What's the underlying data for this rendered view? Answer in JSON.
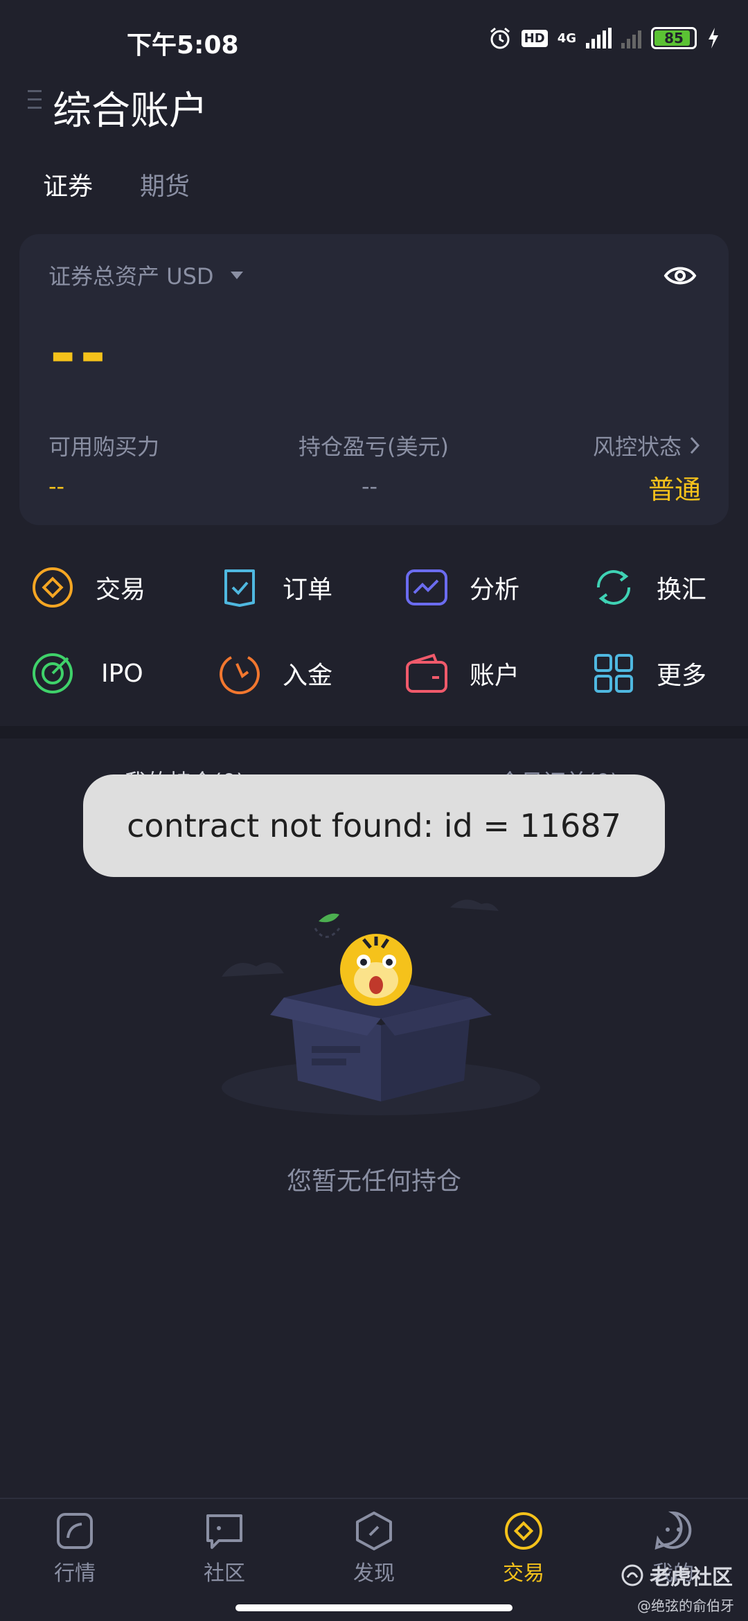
{
  "status_bar": {
    "time": "下午5:08",
    "network": "4G",
    "hd": "HD",
    "battery": "85"
  },
  "header": {
    "title": "综合账户"
  },
  "tabs": [
    {
      "label": "证券",
      "active": true
    },
    {
      "label": "期货",
      "active": false
    }
  ],
  "asset_card": {
    "label": "证券总资产 USD",
    "total_value": "--",
    "buying_power_label": "可用购买力",
    "buying_power_value": "--",
    "pnl_label": "持仓盈亏(美元)",
    "pnl_value": "--",
    "risk_label": "风控状态",
    "risk_value": "普通"
  },
  "actions": [
    {
      "label": "交易",
      "icon": "trade-icon",
      "color": "#f5a623"
    },
    {
      "label": "订单",
      "icon": "order-icon",
      "color": "#4fb8e0"
    },
    {
      "label": "分析",
      "icon": "analysis-icon",
      "color": "#6b6cf0"
    },
    {
      "label": "换汇",
      "icon": "exchange-icon",
      "color": "#3fd2b4"
    },
    {
      "label": "IPO",
      "icon": "ipo-icon",
      "color": "#3fd26a"
    },
    {
      "label": "入金",
      "icon": "deposit-icon",
      "color": "#f2772f"
    },
    {
      "label": "账户",
      "icon": "wallet-icon",
      "color": "#f05a6b"
    },
    {
      "label": "更多",
      "icon": "grid-icon",
      "color": "#4fb8e0"
    }
  ],
  "positions": {
    "tab_holdings": "我的持仓(0)",
    "tab_orders": "今日订单(0)",
    "empty_text": "您暂无任何持仓"
  },
  "toast": {
    "message": "contract not found: id = 11687"
  },
  "bottom_nav": [
    {
      "label": "行情",
      "icon": "market-icon",
      "active": false
    },
    {
      "label": "社区",
      "icon": "community-icon",
      "active": false
    },
    {
      "label": "发现",
      "icon": "discover-icon",
      "active": false
    },
    {
      "label": "交易",
      "icon": "trade-nav-icon",
      "active": true
    },
    {
      "label": "我的",
      "icon": "profile-icon",
      "active": false
    }
  ],
  "watermark": {
    "brand": "老虎社区",
    "author": "@绝弦的俞伯牙"
  },
  "colors": {
    "background": "#20212c",
    "accent": "#f5c21b",
    "muted": "#8a8fa3"
  }
}
